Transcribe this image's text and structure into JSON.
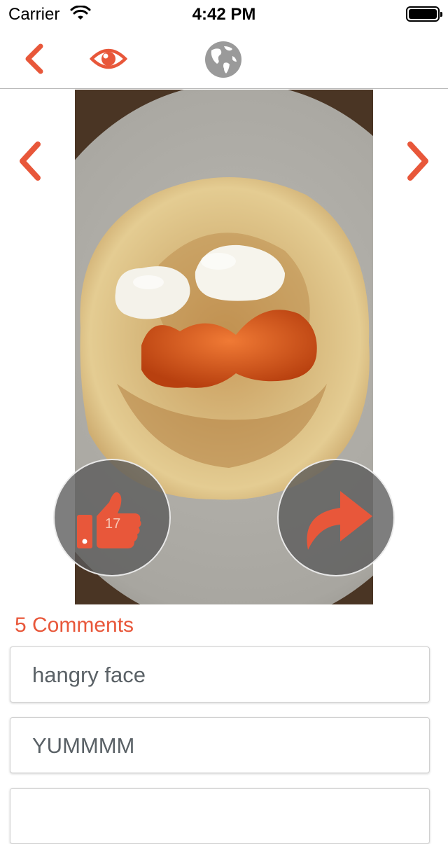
{
  "status_bar": {
    "carrier": "Carrier",
    "time": "4:42 PM"
  },
  "nav": {
    "back_icon": "chevron-left-icon",
    "eye_icon": "eye-icon",
    "globe_icon": "globe-icon"
  },
  "photo": {
    "subject": "blini with sour cream and salmon roe"
  },
  "like": {
    "count": "17",
    "icon": "thumbs-up-icon"
  },
  "share": {
    "icon": "share-arrow-icon"
  },
  "comments": {
    "title": "5 Comments",
    "items": [
      {
        "text": "hangry face"
      },
      {
        "text": "YUMMMM"
      }
    ]
  },
  "colors": {
    "accent": "#e8573a",
    "globe": "#9a9a9a"
  }
}
